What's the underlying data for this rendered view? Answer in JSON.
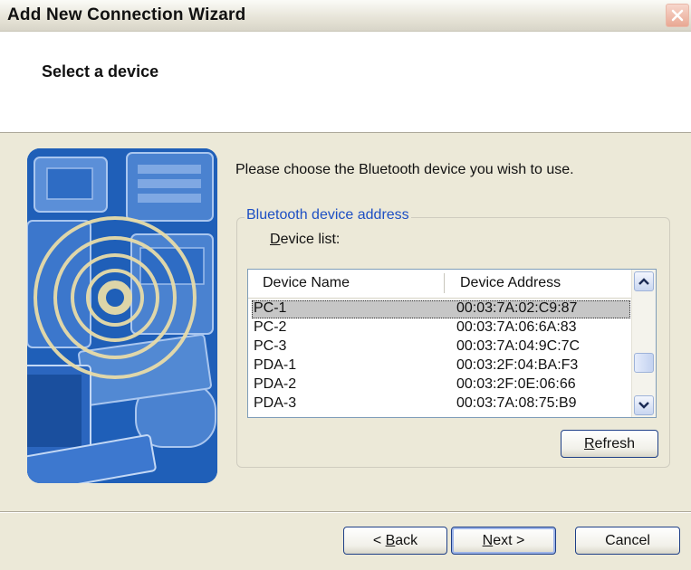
{
  "window": {
    "title": "Add New Connection Wizard"
  },
  "header": {
    "title": "Select a device"
  },
  "instruction": "Please choose the Bluetooth device you wish to use.",
  "group": {
    "legend": "Bluetooth device address",
    "device_list_label_mnemonic": "D",
    "device_list_label_rest": "evice list:"
  },
  "list": {
    "columns": [
      "Device Name",
      "Device Address"
    ],
    "rows": [
      {
        "name": "PC-1",
        "address": "00:03:7A:02:C9:87",
        "selected": true
      },
      {
        "name": "PC-2",
        "address": "00:03:7A:06:6A:83"
      },
      {
        "name": "PC-3",
        "address": "00:03:7A:04:9C:7C"
      },
      {
        "name": "PDA-1",
        "address": "00:03:2F:04:BA:F3"
      },
      {
        "name": "PDA-2",
        "address": "00:03:2F:0E:06:66"
      },
      {
        "name": "PDA-3",
        "address": "00:03:7A:08:75:B9"
      }
    ]
  },
  "buttons": {
    "refresh": {
      "mnemonic": "R",
      "rest": "efresh"
    },
    "back": {
      "prefix": "< ",
      "mnemonic": "B",
      "rest": "ack"
    },
    "next": {
      "mnemonic": "N",
      "rest": "ext >"
    },
    "cancel": {
      "label": "Cancel"
    }
  },
  "colors": {
    "window_bg": "#ece9d8",
    "legend_blue": "#1d4fc4",
    "selection": "#c6c6c6",
    "illustration_blue": "#1f5fb8"
  },
  "icons": {
    "close": "close-x-icon",
    "scroll_up": "arrow-up-icon",
    "scroll_down": "arrow-down-icon",
    "illustration": "bluetooth-devices-illustration"
  }
}
